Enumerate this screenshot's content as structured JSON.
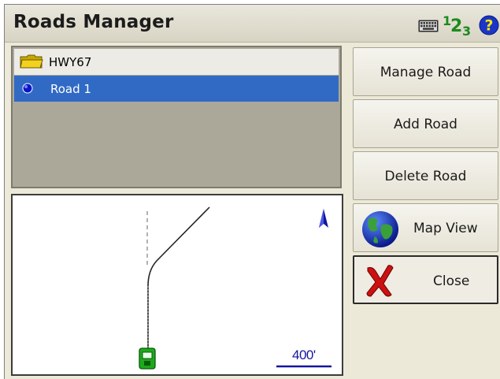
{
  "window": {
    "title": "Roads Manager"
  },
  "toolbar_icons": [
    "keyboard-icon",
    "numeric-input-icon",
    "help-icon"
  ],
  "numeric_icon": {
    "digit1": "1",
    "digit2": "2",
    "digit3": "3"
  },
  "roads": {
    "folder": {
      "label": "HWY67",
      "icon": "folder-icon"
    },
    "items": [
      {
        "label": "Road 1",
        "icon": "blue-dot-icon",
        "selected": true
      }
    ]
  },
  "map": {
    "scale_label": "400'",
    "icons": [
      "north-arrow-icon",
      "instrument-icon"
    ]
  },
  "buttons": {
    "manage_road": "Manage Road",
    "add_road": "Add Road",
    "delete_road": "Delete Road",
    "map_view": "Map View",
    "close": "Close"
  },
  "colors": {
    "selection": "#316ac5",
    "window_bg": "#ece9d8",
    "list_bg": "#aca899",
    "scale": "#1515a0",
    "green": "#1c8a1c",
    "close_red": "#cc1111"
  }
}
